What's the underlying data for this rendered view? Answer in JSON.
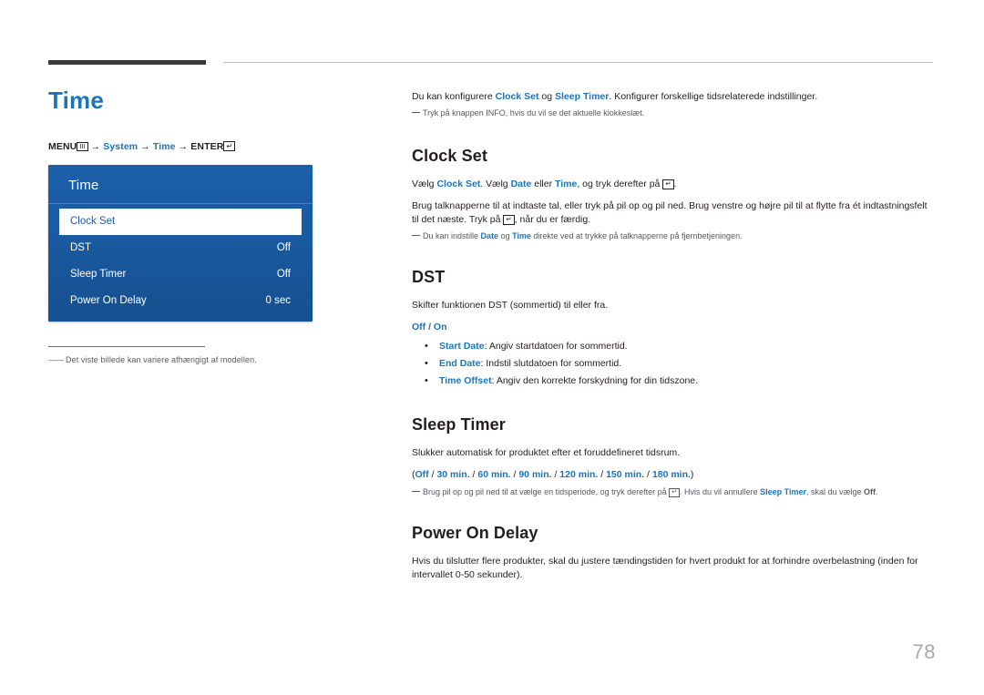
{
  "page": {
    "number": "78"
  },
  "left": {
    "title": "Time",
    "menu_path": {
      "menu": "MENU",
      "menu_icon": "III",
      "arrow1": "→",
      "system": "System",
      "arrow2": "→",
      "time": "Time",
      "arrow3": "→",
      "enter": "ENTER",
      "enter_icon": "↵"
    },
    "osd": {
      "title": "Time",
      "rows": [
        {
          "label": "Clock Set",
          "value": "",
          "selected": true
        },
        {
          "label": "DST",
          "value": "Off",
          "selected": false
        },
        {
          "label": "Sleep Timer",
          "value": "Off",
          "selected": false
        },
        {
          "label": "Power On Delay",
          "value": "0 sec",
          "selected": false
        }
      ]
    },
    "note": "Det viste billede kan variere afhængigt af modellen."
  },
  "right": {
    "intro": {
      "p1_a": "Du kan konfigurere ",
      "p1_clock": "Clock Set",
      "p1_b": " og ",
      "p1_sleep": "Sleep Timer",
      "p1_c": ". Konfigurer forskellige tidsrelaterede indstillinger.",
      "note": "Tryk på knappen INFO, hvis du vil se det aktuelle klokkeslæt.",
      "note_bold": "INFO"
    },
    "sections": [
      {
        "heading": "Clock Set",
        "line1_a": "Vælg ",
        "line1_clock": "Clock Set",
        "line1_b": ". Vælg ",
        "line1_date": "Date",
        "line1_c": " eller ",
        "line1_time": "Time",
        "line1_d": ", og tryk derefter på ",
        "line2": "Brug talknapperne til at indtaste tal, eller tryk på pil op og pil ned. Brug venstre og højre pil til at flytte fra ét indtastningsfelt til det næste. Tryk på",
        "line2_end": ", når du er færdig.",
        "note_a": "Du kan indstille ",
        "note_date": "Date",
        "note_b": " og ",
        "note_time": "Time",
        "note_c": " direkte ved at trykke på talknapperne på fjernbetjeningen."
      },
      {
        "heading": "DST",
        "line1": "Skifter funktionen DST (sommertid) til eller fra.",
        "options": "Off / On",
        "bullets": [
          {
            "term": "Start Date",
            "rest": ": Angiv startdatoen for sommertid."
          },
          {
            "term": "End Date",
            "rest": ": Indstil slutdatoen for sommertid."
          },
          {
            "term": "Time Offset",
            "rest": ": Angiv den korrekte forskydning for din tidszone."
          }
        ]
      },
      {
        "heading": "Sleep Timer",
        "line1": "Slukker automatisk for produktet efter et foruddefineret tidsrum.",
        "options_open": "(",
        "options_list": [
          "Off",
          "30 min.",
          "60 min.",
          "90 min.",
          "120 min.",
          "150 min.",
          "180 min."
        ],
        "options_close": ")",
        "note_a": "Brug pil op og pil ned til at vælge en tidsperiode, og tryk derefter på ",
        "note_b": ". Hvis du vil annullere ",
        "note_sleep": "Sleep Timer",
        "note_c": ", skal du vælge ",
        "note_off": "Off",
        "note_d": "."
      },
      {
        "heading": "Power On Delay",
        "line1": "Hvis du tilslutter flere produkter, skal du justere tændingstiden for hvert produkt for at forhindre overbelastning (inden for intervallet 0-50 sekunder)."
      }
    ]
  },
  "colors": {
    "accent_blue": "#1b75bb",
    "osd_blue": "#1a5ba2",
    "rule_dark": "#3b3b3d",
    "page_num": "#a7a9ac"
  }
}
